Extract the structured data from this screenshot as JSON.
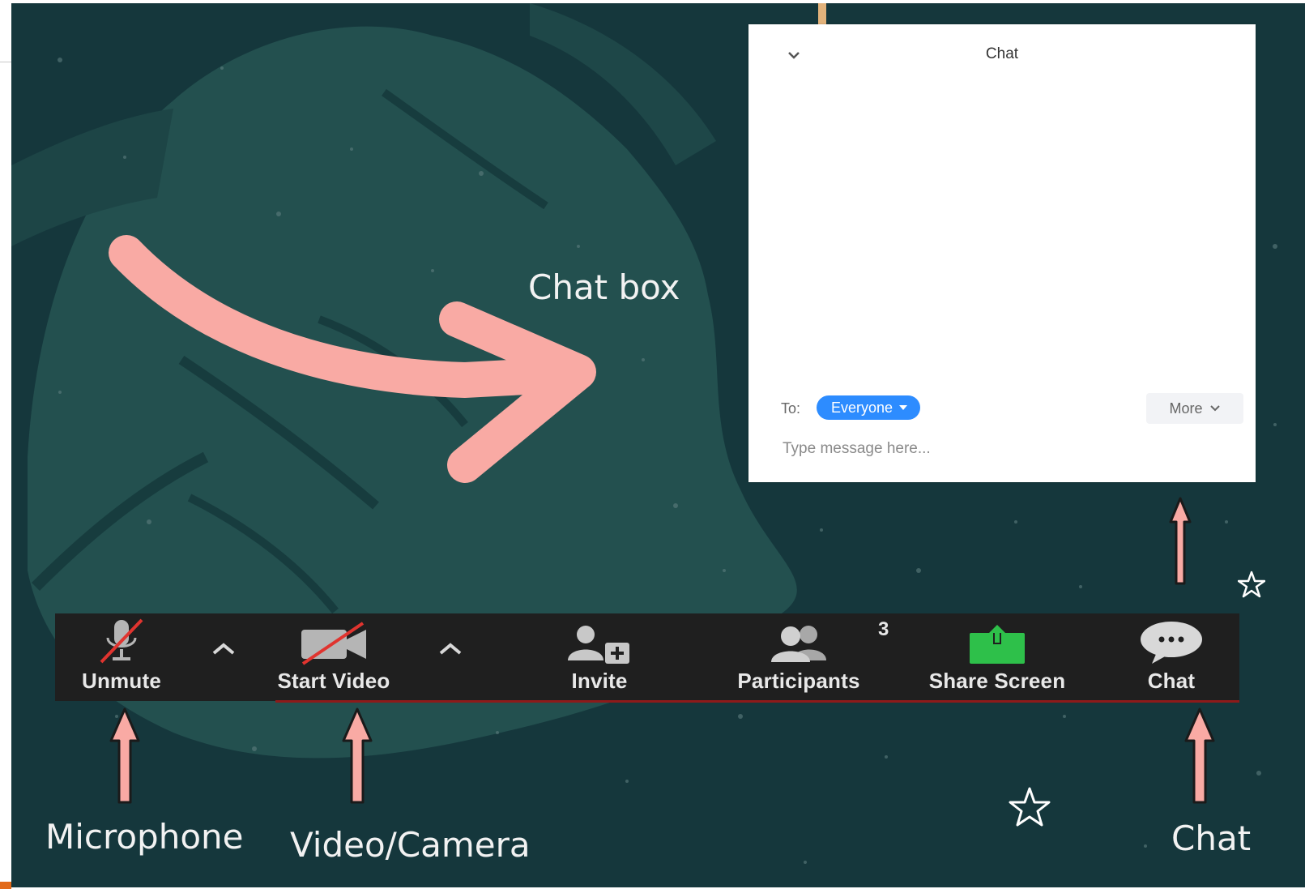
{
  "chat_panel": {
    "title": "Chat",
    "to_label": "To:",
    "recipient": "Everyone",
    "more_label": "More",
    "message_placeholder": "Type message here..."
  },
  "toolbar": {
    "unmute_label": "Unmute",
    "start_video_label": "Start Video",
    "invite_label": "Invite",
    "participants_label": "Participants",
    "participants_count": "3",
    "share_screen_label": "Share Screen",
    "chat_label": "Chat"
  },
  "annotations": {
    "chat_box": "Chat box",
    "microphone": "Microphone",
    "video_camera": "Video/Camera",
    "chat": "Chat"
  },
  "colors": {
    "background": "#15373c",
    "leaf": "#23504f",
    "arrow": "#f9aaa4",
    "toolbar": "#1f1f1f",
    "everyone_pill": "#2d8cff",
    "share_green": "#2ec04a",
    "mute_slash": "#e0342f"
  },
  "icons": {
    "collapse": "chevron-down-icon",
    "unmute": "microphone-muted-icon",
    "start_video": "camera-off-icon",
    "invite": "add-user-icon",
    "participants": "people-icon",
    "share_screen": "share-screen-icon",
    "chat": "chat-bubble-icon",
    "annotation_arrow": "curved-arrow-icon",
    "decoration": "star-outline-icon"
  }
}
